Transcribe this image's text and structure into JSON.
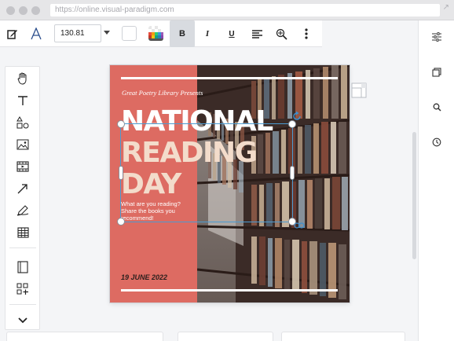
{
  "browser": {
    "url": "https://online.visual-paradigm.com"
  },
  "toolbar": {
    "font_size": "130.81",
    "bold_label": "B",
    "italic_label": "I",
    "underline_label": "U"
  },
  "canvas": {
    "subtitle": "Great Poetry Library Presents",
    "headline_line1": "NATIONAL",
    "headline_line2": "READING",
    "headline_line3": "DAY",
    "question": "What are you reading? Share the books you recommend!",
    "date": "19 JUNE 2022"
  },
  "colors": {
    "accent_red": "#dd6b62",
    "headline_white": "#ffffff",
    "headline_cream": "#f3dccb",
    "selection_blue": "#4b9bd1"
  },
  "icons": {
    "left_palette": [
      "hand-icon",
      "text-icon",
      "shapes-icon",
      "image-icon",
      "video-icon",
      "arrow-icon",
      "pen-icon",
      "table-icon",
      "page-icon",
      "add-widget-icon",
      "chevron-down-icon"
    ],
    "right_panel": [
      "sliders-icon",
      "layers-icon",
      "search-icon",
      "history-icon"
    ]
  }
}
